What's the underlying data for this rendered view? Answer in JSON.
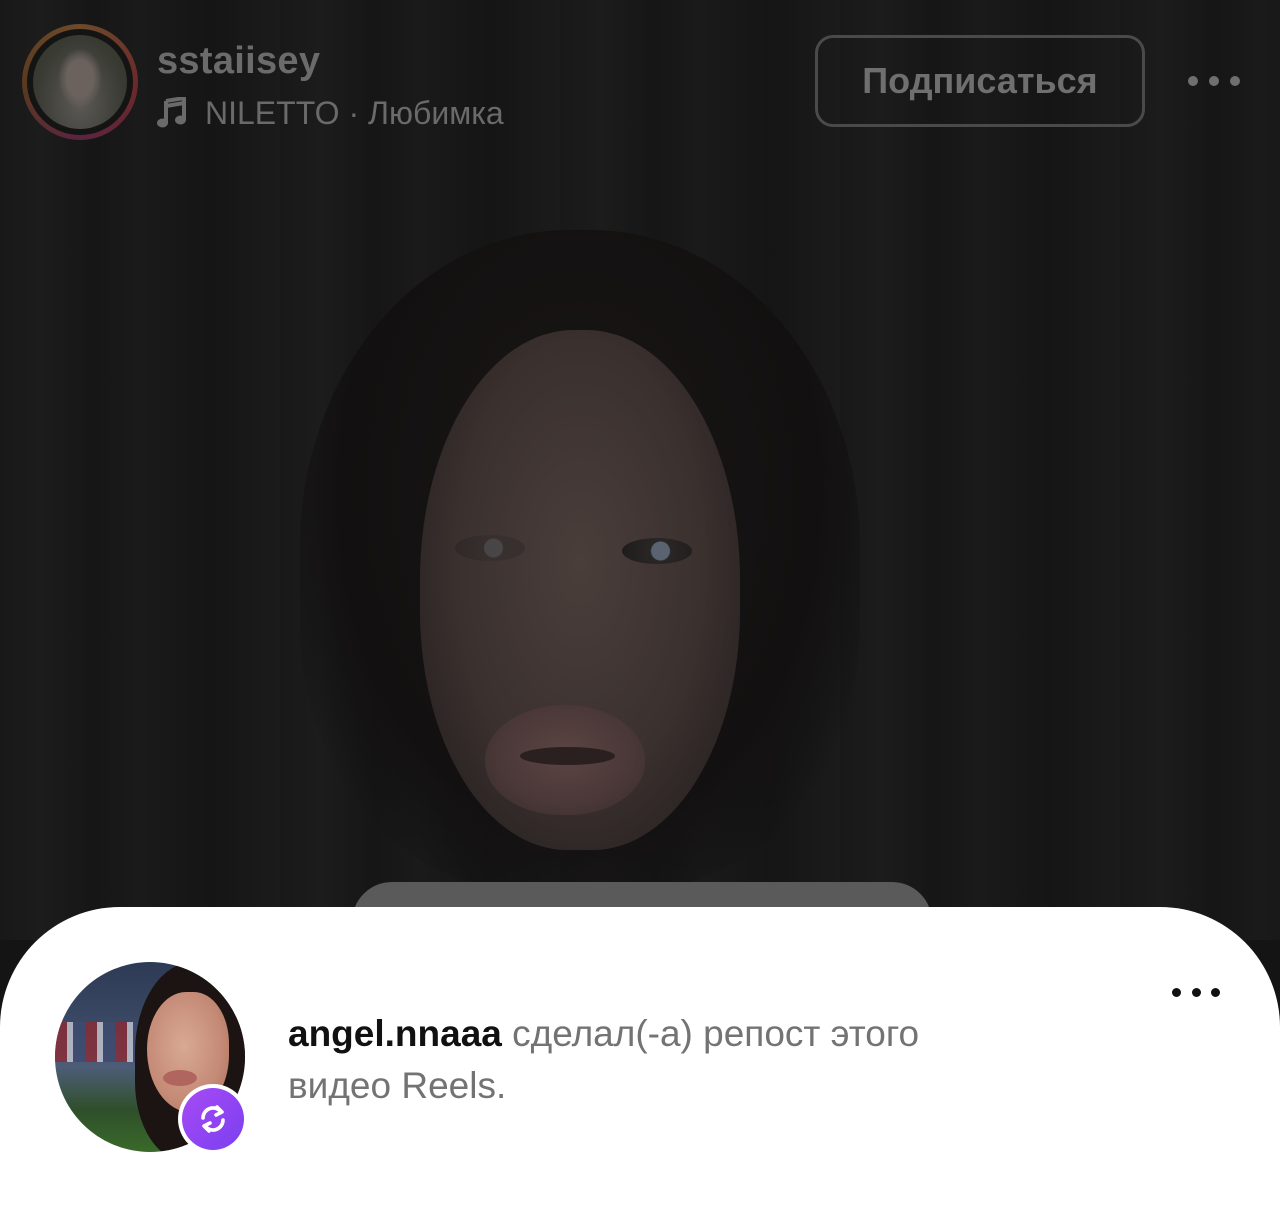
{
  "header": {
    "username": "sstaiisey",
    "music": "NILETTO · Любимка",
    "follow_label": "Подписаться"
  },
  "repost": {
    "username": "angel.nnaaa",
    "text_line1": " сделал(-а) репост этого",
    "text_line2": "видео Reels."
  },
  "icons": {
    "music": "music-note-icon",
    "more": "more-horizontal-icon",
    "repost": "repost-icon"
  },
  "colors": {
    "repost_badge": "#9b48f3",
    "sheet_bg": "#ffffff",
    "video_bg": "#141414"
  }
}
